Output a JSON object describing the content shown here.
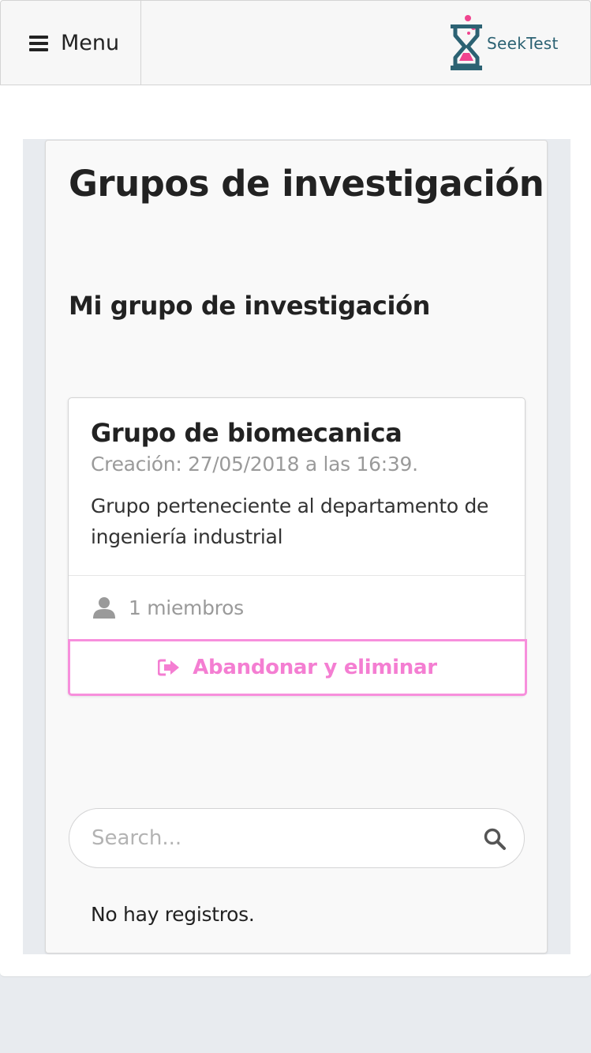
{
  "header": {
    "menu_label": "Menu",
    "logo_text": "SeekTest"
  },
  "colors": {
    "accent_pink": "#f47ed2",
    "logo_teal": "#2c6273"
  },
  "main": {
    "page_title": "Grupos de investigación",
    "section_title": "Mi grupo de investigación",
    "group": {
      "name": "Grupo de biomecanica",
      "created": "Creación: 27/05/2018 a las  16:39.",
      "description": "Grupo perteneciente al departamento de ingeniería industrial",
      "members": "1 miembros",
      "leave_button": "Abandonar y eliminar"
    },
    "search": {
      "placeholder": "Search...",
      "value": ""
    },
    "empty_message": "No hay registros."
  }
}
